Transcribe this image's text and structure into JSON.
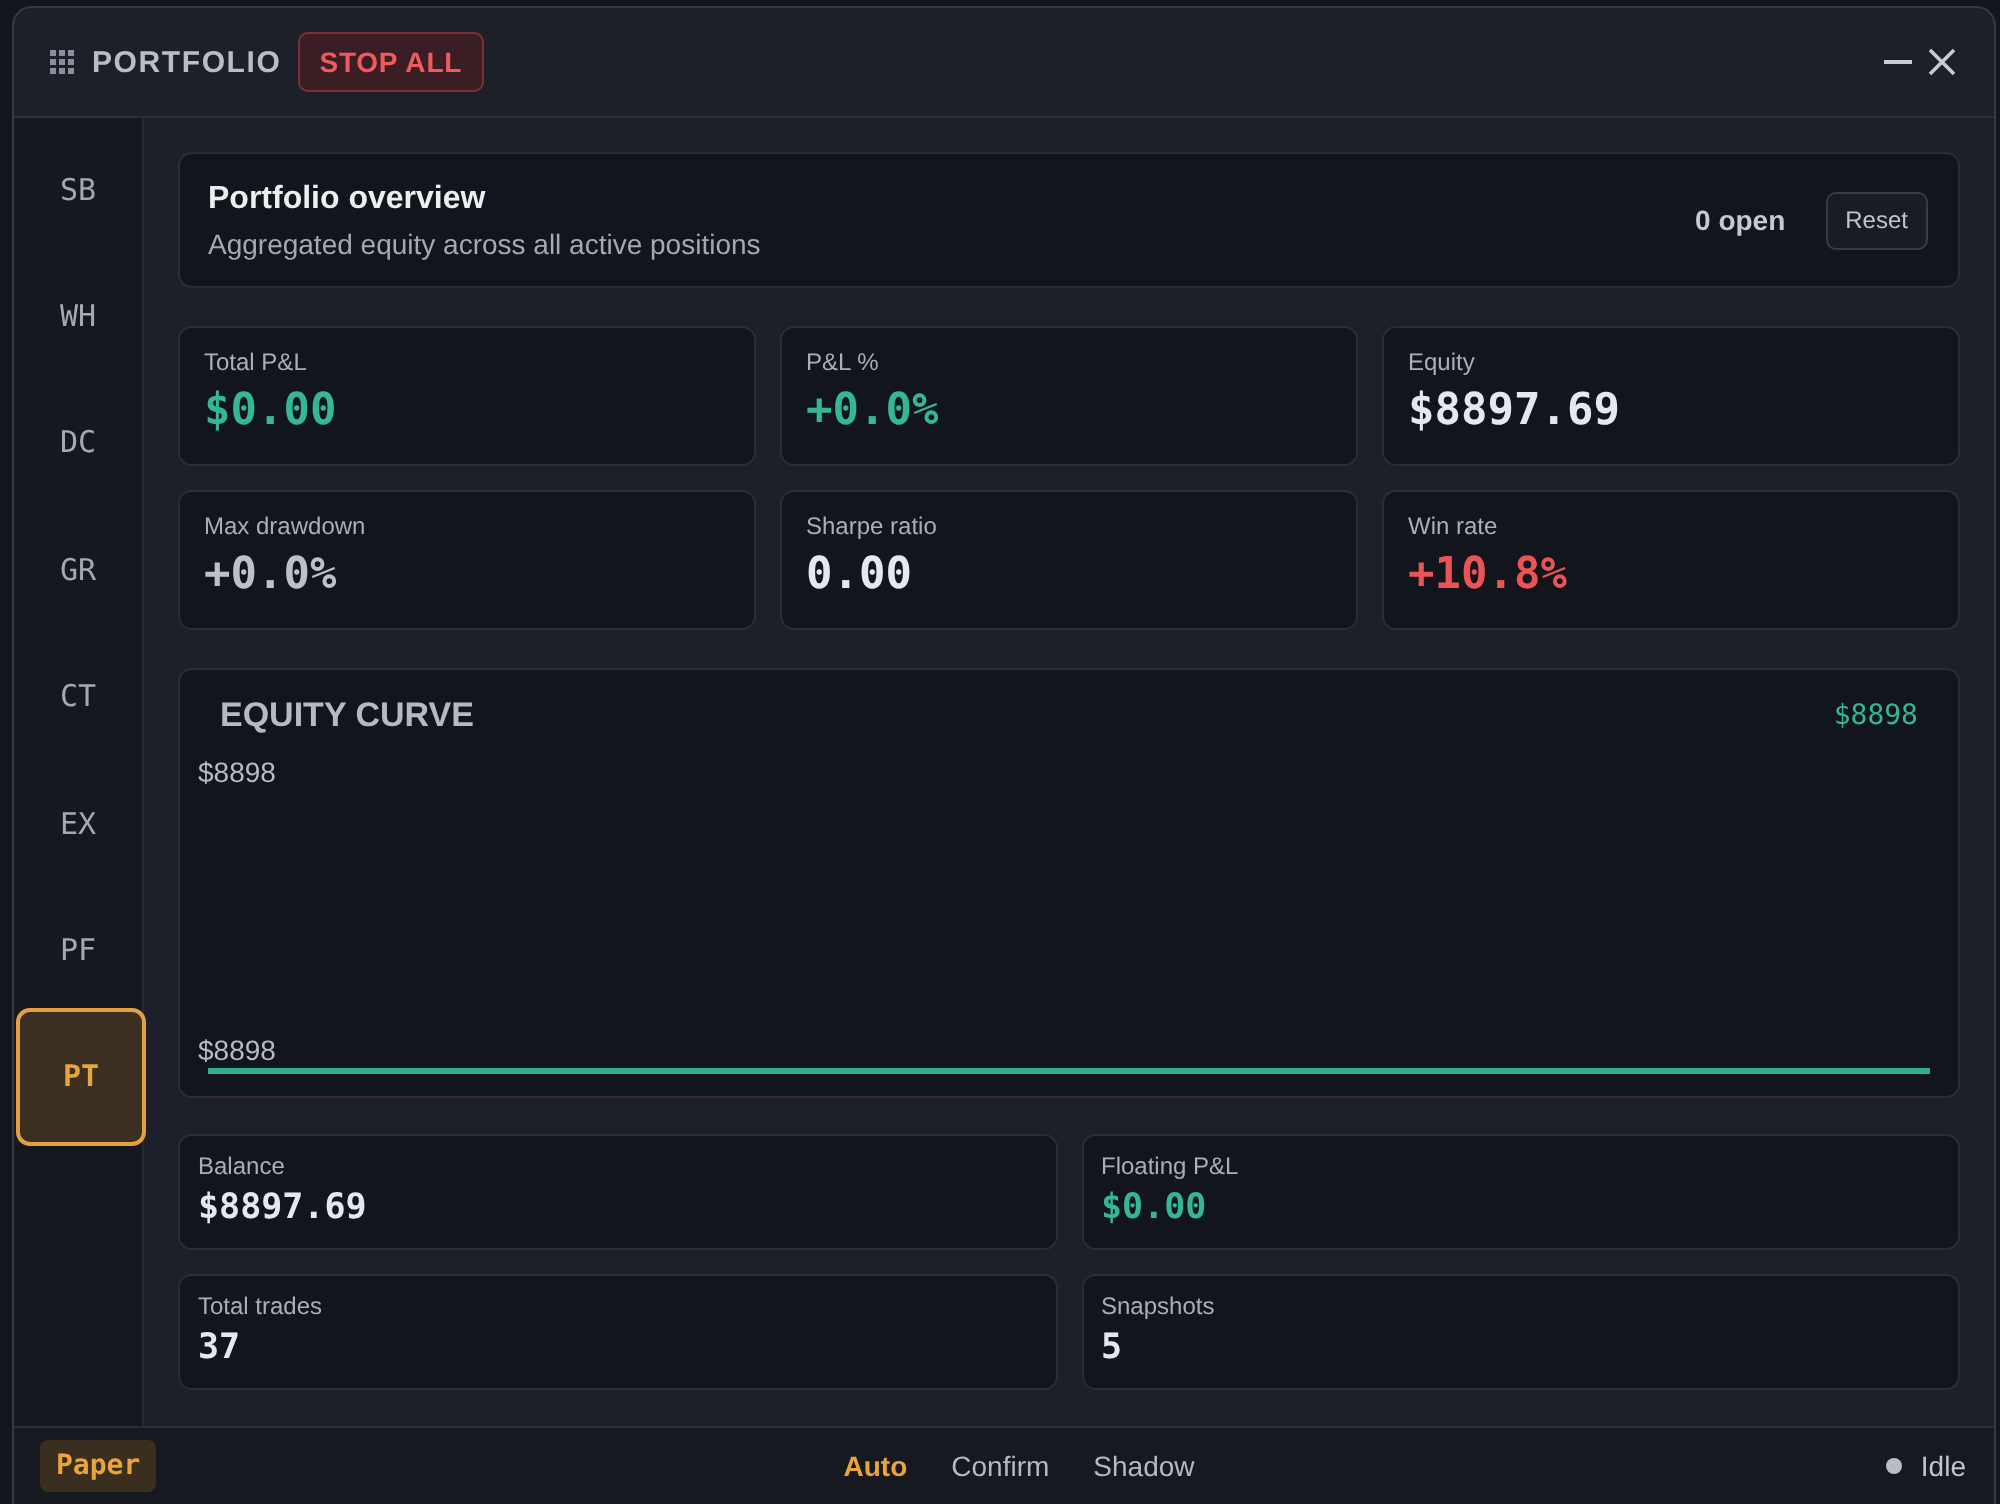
{
  "window": {
    "title": "PORTFOLIO",
    "stop_button": "STOP ALL"
  },
  "sidebar": {
    "items": [
      {
        "label": "SB",
        "selected": false
      },
      {
        "label": "WH",
        "selected": false
      },
      {
        "label": "DC",
        "selected": false
      },
      {
        "label": "GR",
        "selected": false
      },
      {
        "label": "CT",
        "selected": false
      },
      {
        "label": "EX",
        "selected": false
      },
      {
        "label": "PF",
        "selected": false
      },
      {
        "label": "PT",
        "selected": true
      }
    ]
  },
  "overview": {
    "title": "Portfolio overview",
    "subtitle": "Aggregated equity across all active positions",
    "open_count": "0 open",
    "reset_button": "Reset"
  },
  "metrics": [
    {
      "label": "Total P&L",
      "value": "$0.00",
      "color": "#35b793"
    },
    {
      "label": "P&L %",
      "value": "+0.0%",
      "color": "#35b793"
    },
    {
      "label": "Equity",
      "value": "$8897.69",
      "color": "#e6e8ee"
    },
    {
      "label": "Max drawdown",
      "value": "+0.0%",
      "color": "#bcc0c9"
    },
    {
      "label": "Sharpe ratio",
      "value": "0.00",
      "color": "#e6e8ee"
    },
    {
      "label": "Win rate",
      "value": "+10.8%",
      "color": "#ea5455"
    }
  ],
  "equity_curve": {
    "title": "EQUITY CURVE",
    "latest": "$8898",
    "max_label": "$8898",
    "min_label": "$8898"
  },
  "account": [
    {
      "label": "Balance",
      "value": "$8897.69",
      "color": "#e6e8ee"
    },
    {
      "label": "Floating P&L",
      "value": "$0.00",
      "color": "#35b793"
    },
    {
      "label": "Total trades",
      "value": "37",
      "color": "#e6e8ee"
    },
    {
      "label": "Snapshots",
      "value": "5",
      "color": "#e6e8ee"
    }
  ],
  "status_bar": {
    "badge": "Paper",
    "modes": [
      {
        "label": "Auto",
        "selected": true
      },
      {
        "label": "Confirm",
        "selected": false
      },
      {
        "label": "Shadow",
        "selected": false
      }
    ],
    "status": {
      "label": "Idle",
      "active": false
    }
  }
}
